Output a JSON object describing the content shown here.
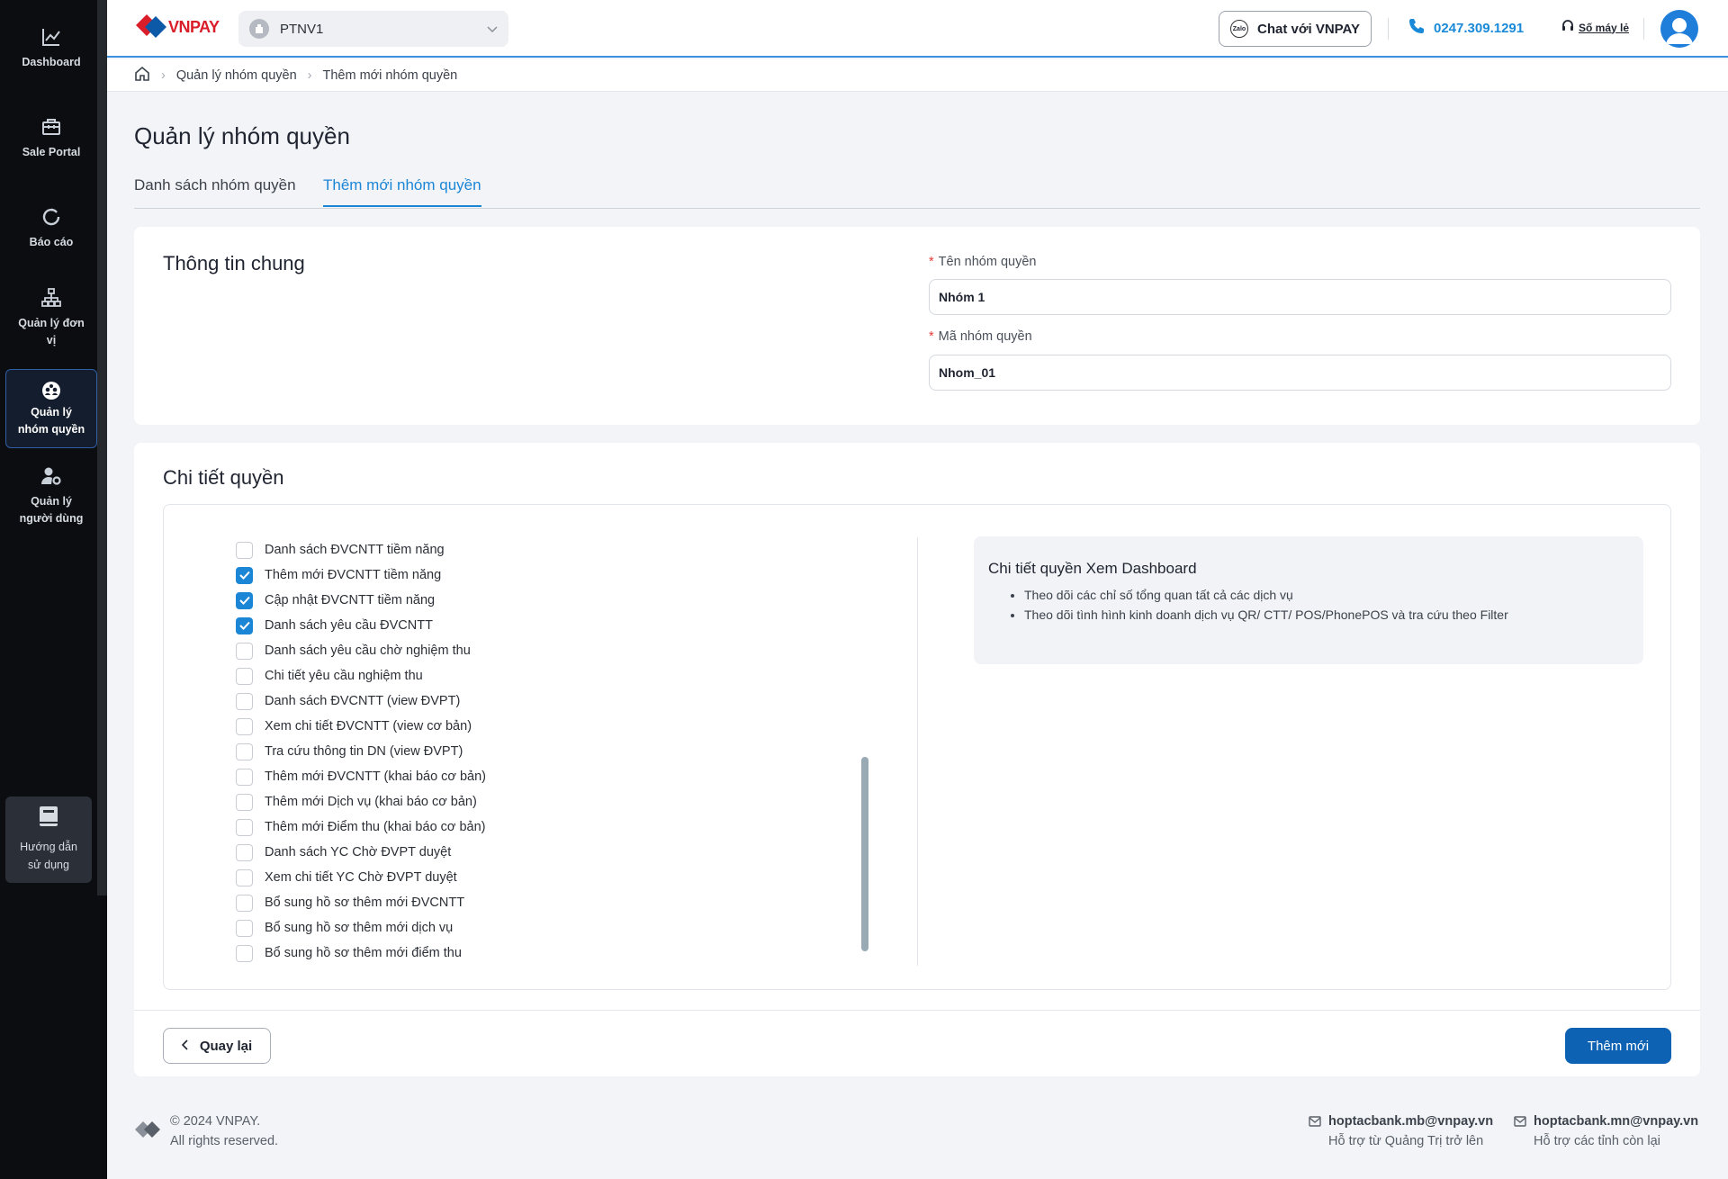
{
  "sidebar": {
    "items": [
      {
        "label": "Dashboard",
        "icon": "chart-line-icon"
      },
      {
        "label": "Sale Portal",
        "icon": "briefcase-icon"
      },
      {
        "label": "Báo cáo",
        "icon": "refresh-icon"
      },
      {
        "label": "Quản lý đơn vị",
        "icon": "org-tree-icon"
      },
      {
        "label": "Quản lý nhóm quyền",
        "icon": "group-icon",
        "active": true
      },
      {
        "label": "Quản lý người dùng",
        "icon": "user-settings-icon"
      }
    ],
    "guide_label": "Hướng dẫn sử dụng"
  },
  "header": {
    "logo_text": "VNPAY",
    "org_selected": "PTNV1",
    "chat_label": "Chat với VNPAY",
    "phone": "0247.309.1291",
    "hotline_label": "Số máy lẻ"
  },
  "breadcrumb": [
    "Quản lý nhóm quyền",
    "Thêm mới nhóm quyền"
  ],
  "page_title": "Quản lý nhóm quyền",
  "tabs": [
    {
      "label": "Danh sách nhóm quyền",
      "active": false
    },
    {
      "label": "Thêm mới nhóm quyền",
      "active": true
    }
  ],
  "general": {
    "title": "Thông tin chung",
    "name_label": "Tên nhóm quyền",
    "name_value": "Nhóm 1",
    "code_label": "Mã nhóm quyền",
    "code_value": "Nhom_01"
  },
  "permissions": {
    "title": "Chi tiết quyền",
    "items": [
      {
        "label": "Danh sách ĐVCNTT tiềm năng",
        "checked": false
      },
      {
        "label": "Thêm mới ĐVCNTT tiềm năng",
        "checked": true
      },
      {
        "label": "Cập nhật ĐVCNTT tiềm năng",
        "checked": true
      },
      {
        "label": "Danh sách yêu cầu ĐVCNTT",
        "checked": true
      },
      {
        "label": "Danh sách yêu cầu chờ nghiệm thu",
        "checked": false
      },
      {
        "label": "Chi tiết yêu cầu nghiệm thu",
        "checked": false
      },
      {
        "label": "Danh sách ĐVCNTT (view ĐVPT)",
        "checked": false
      },
      {
        "label": "Xem chi tiết ĐVCNTT (view cơ bản)",
        "checked": false
      },
      {
        "label": "Tra cứu thông tin DN (view ĐVPT)",
        "checked": false
      },
      {
        "label": "Thêm mới ĐVCNTT (khai báo cơ bản)",
        "checked": false
      },
      {
        "label": "Thêm mới Dịch vụ (khai báo cơ bản)",
        "checked": false
      },
      {
        "label": "Thêm mới Điểm thu (khai báo cơ bản)",
        "checked": false
      },
      {
        "label": "Danh sách YC Chờ ĐVPT duyệt",
        "checked": false
      },
      {
        "label": "Xem chi tiết YC Chờ ĐVPT duyệt",
        "checked": false
      },
      {
        "label": "Bổ sung hồ sơ thêm mới ĐVCNTT",
        "checked": false
      },
      {
        "label": "Bổ sung hồ sơ thêm mới dịch vụ",
        "checked": false
      },
      {
        "label": "Bổ sung hồ sơ thêm mới điểm thu",
        "checked": false
      }
    ],
    "detail_title": "Chi tiết quyền Xem Dashboard",
    "detail_points": [
      "Theo dõi các chỉ số tổng quan tất cả các dịch vụ",
      "Theo dõi tình hình kinh doanh dịch vụ QR/ CTT/ POS/PhonePOS và tra cứu theo Filter"
    ]
  },
  "actions": {
    "back_label": "Quay lại",
    "add_label": "Thêm mới"
  },
  "footer": {
    "copyright": "© 2024 VNPAY.",
    "rights": "All rights reserved.",
    "contacts": [
      {
        "email": "hoptacbank.mb@vnpay.vn",
        "note": "Hỗ trợ từ Quảng Trị trở lên"
      },
      {
        "email": "hoptacbank.mn@vnpay.vn",
        "note": "Hỗ trợ các tỉnh còn lại"
      }
    ]
  },
  "colors": {
    "accent": "#1c86d6",
    "primary_button": "#0e62b3",
    "sidebar_bg": "#0b0d10",
    "page_bg": "#f2f4f7"
  }
}
